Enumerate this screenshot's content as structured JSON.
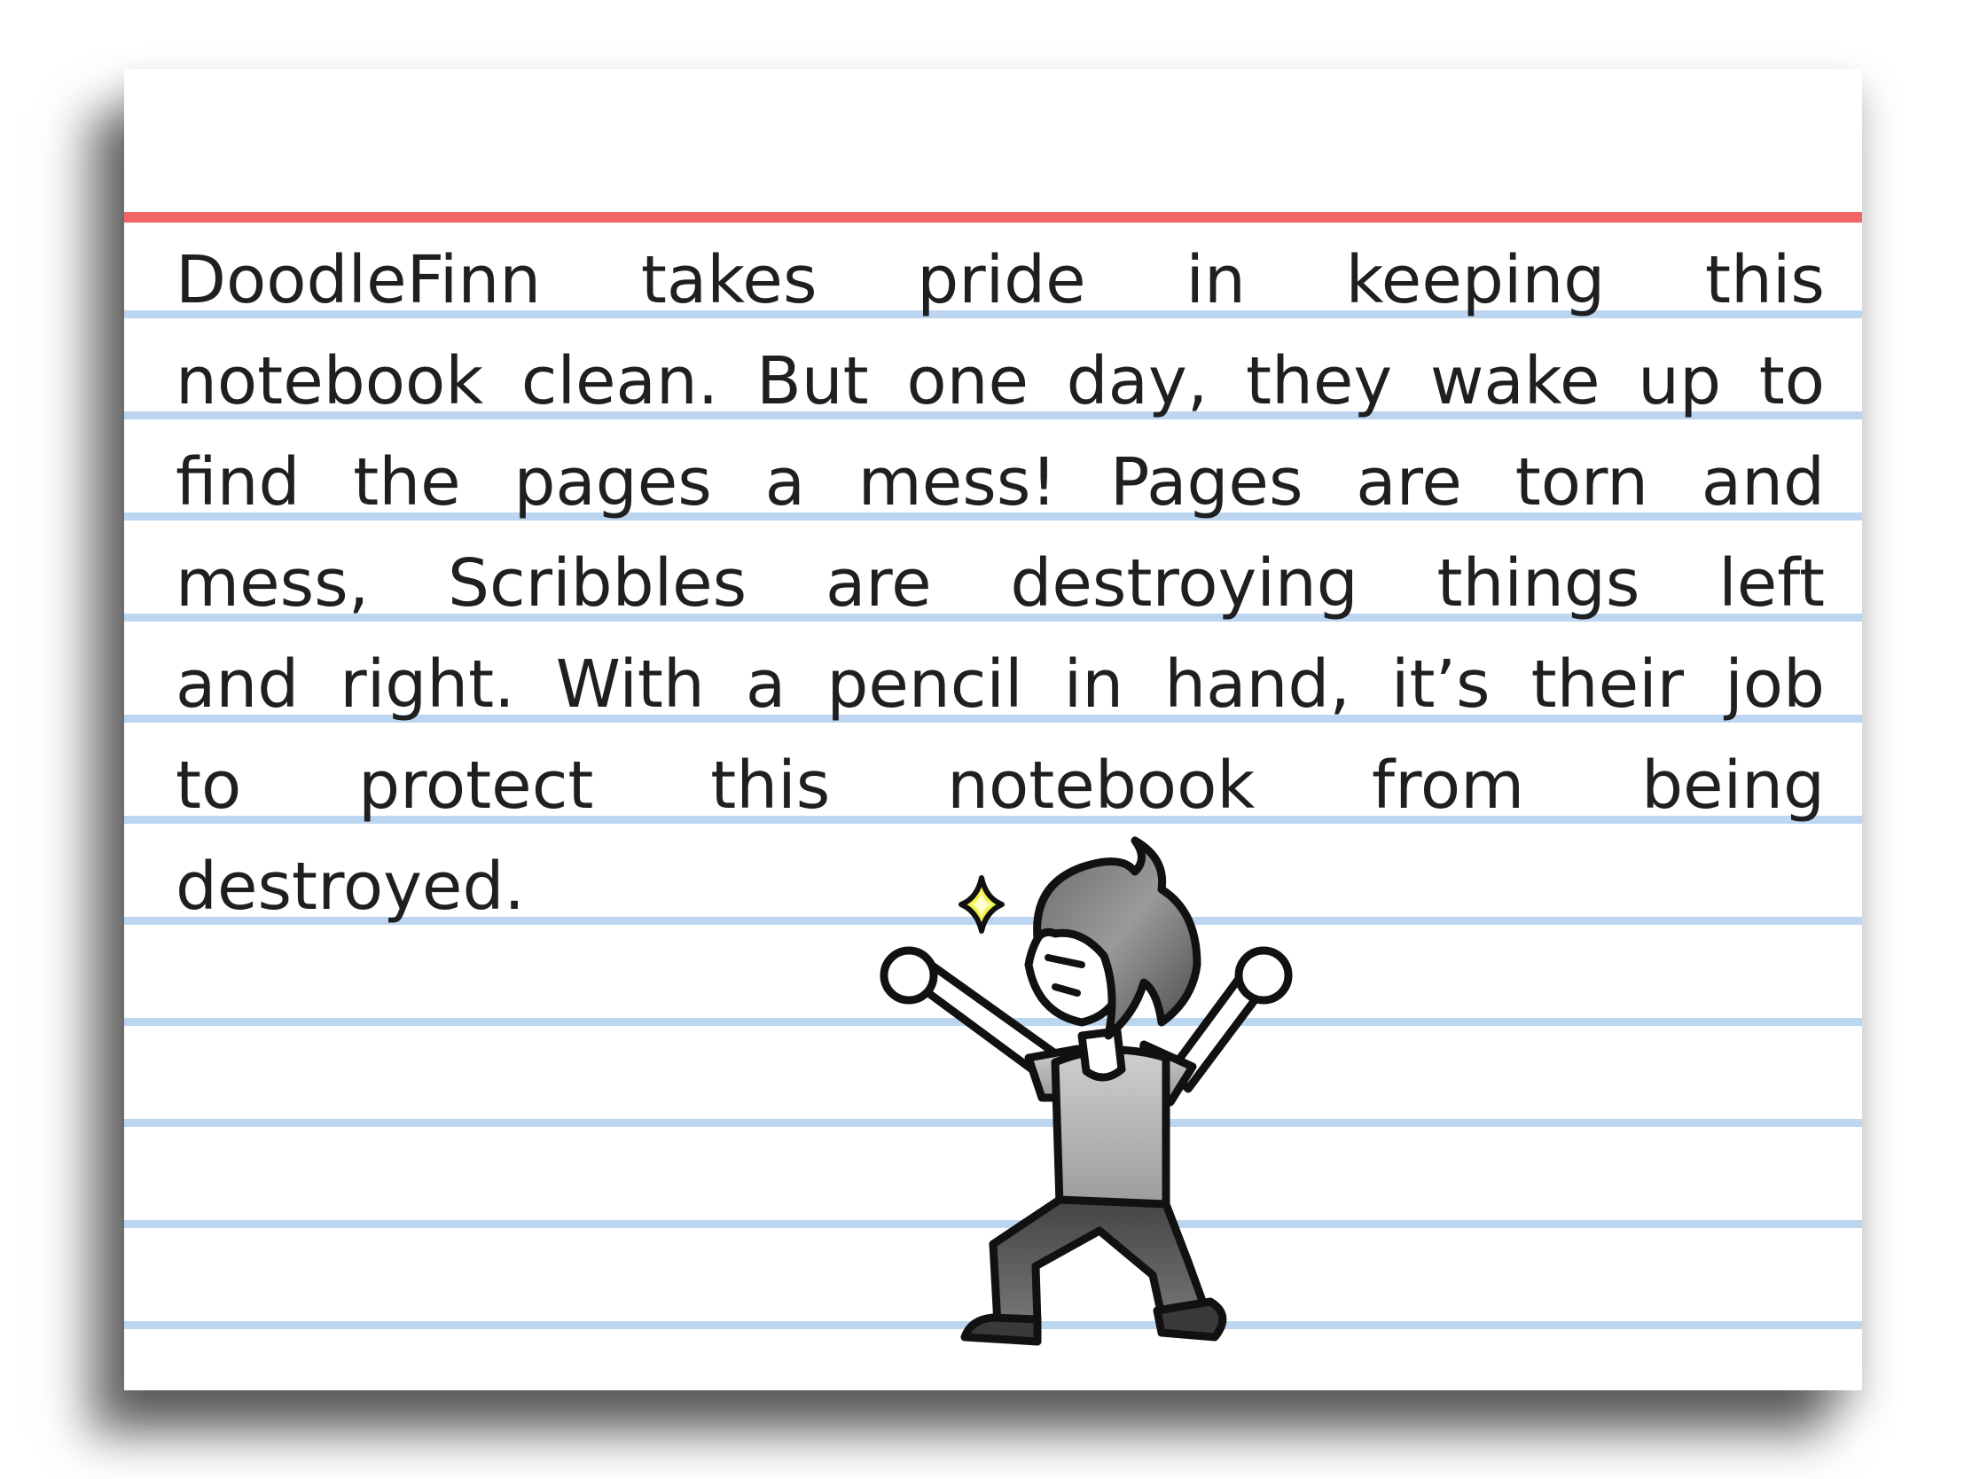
{
  "story": {
    "lines": [
      "DoodleFinn takes pride in keeping this",
      "notebook clean. But one day, they wake up to",
      "find the pages a mess! Pages are torn and",
      "mess, Scribbles are destroying things left",
      "and right. With a pencil in hand, it’s their job",
      "to protect this notebook from being",
      "destroyed."
    ]
  },
  "colors": {
    "margin_line": "#f26566",
    "ruled_line": "#bcd6f2",
    "ink": "#1f1f1f",
    "sparkle": "#f4f54a"
  },
  "icons": {
    "character": "doodlefinn-cheering-icon",
    "sparkle": "sparkle-icon"
  }
}
